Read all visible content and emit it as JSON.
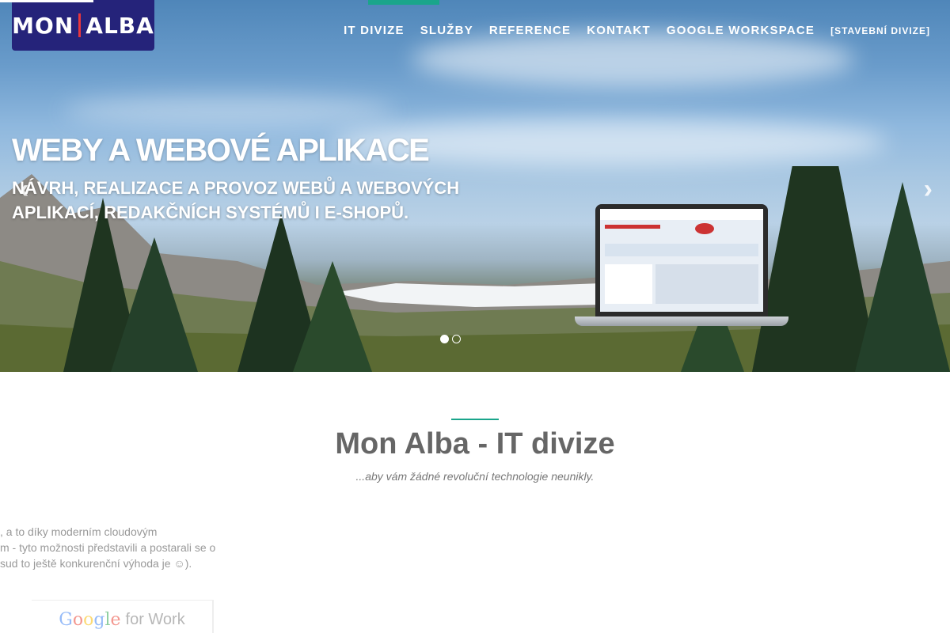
{
  "logo": {
    "part1": "MON",
    "part2": "ALBA"
  },
  "nav": {
    "items": [
      "IT DIVIZE",
      "SLUŽBY",
      "REFERENCE",
      "KONTAKT",
      "GOOGLE WORKSPACE"
    ],
    "extra": "[STAVEBNÍ DIVIZE]",
    "active_index": 0,
    "accent_color": "#1aa58b"
  },
  "hero": {
    "title": "WEBY A WEBOVÉ APLIKACE",
    "subtitle": "NÁVRH, REALIZACE A PROVOZ WEBŮ A WEBOVÝCH APLIKACÍ, REDAKČNÍCH SYSTÉMŮ I E-SHOPŮ.",
    "prev_icon": "chevron-left-icon",
    "next_icon": "chevron-right-icon",
    "slides": 2,
    "active_slide": 0
  },
  "section": {
    "title": "Mon Alba - IT divize",
    "tagline": "...aby vám žádné revoluční technologie neunikly.",
    "paragraph_lines": [
      ", a to díky moderním cloudovým",
      "m - tyto možnosti představili a postarali se o",
      "sud to ještě konkurenční výhoda je ☺)."
    ],
    "badge": {
      "google": "Google",
      "suffix": "for Work"
    }
  },
  "colors": {
    "brand": "#25237a",
    "accent": "#1aa58b",
    "logo_bar": "#e8363d"
  }
}
